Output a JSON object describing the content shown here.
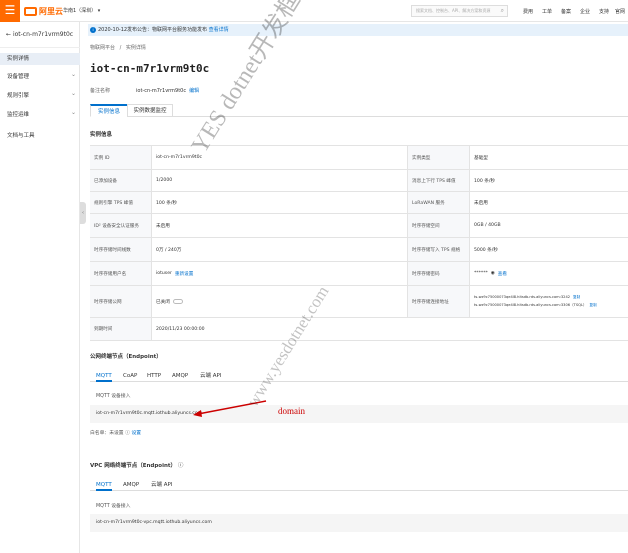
{
  "topbar": {
    "brand": "阿里云",
    "region": "华南1（深圳）",
    "search_placeholder": "搜索文档、控制台、API、解决方案和资源",
    "nav": [
      "费用",
      "工单",
      "备案",
      "企业",
      "支持",
      "官网"
    ]
  },
  "sidebar": {
    "back_label": "iot-cn-m7r1vrm9t0c",
    "items": [
      {
        "label": "实例详情",
        "active": true,
        "expandable": false
      },
      {
        "label": "设备管理",
        "active": false,
        "expandable": true
      },
      {
        "label": "规则引擎",
        "active": false,
        "expandable": true
      },
      {
        "label": "监控运维",
        "active": false,
        "expandable": true
      },
      {
        "label": "文档与工具",
        "active": false,
        "expandable": false
      }
    ]
  },
  "notice": {
    "text": "2020-10-12发布公告：物联网平台服务功能发布",
    "link": "查看详情"
  },
  "breadcrumb": [
    "物联网平台",
    "/",
    "实例详情"
  ],
  "page": {
    "title": "iot-cn-m7r1vrm9t0c",
    "remark_label": "备注名称",
    "remark_value": "iot-cn-m7r1vrm9t0c",
    "remark_edit": "编辑"
  },
  "tabs": [
    {
      "label": "实例信息",
      "active": true
    },
    {
      "label": "实例数据监控",
      "active": false
    }
  ],
  "instance_section": "实例信息",
  "instance_rows": [
    {
      "k1": "实例 ID",
      "v1": "iot-cn-m7r1vrm9t0c",
      "k2": "实例类型",
      "v2": "基础型"
    },
    {
      "k1": "已添加设备",
      "v1": "1/2000",
      "k2": "消息上下行 TPS 峰值",
      "v2": "100 条/秒"
    },
    {
      "k1": "规则引擎 TPS 峰值",
      "v1": "100 条/秒",
      "k2": "LoRaWAN 服务",
      "v2": "未启用"
    },
    {
      "k1": "ID² 设备安全认证服务",
      "v1": "未启用",
      "k2": "时序存储空间",
      "v2": "0GB / 40GB"
    },
    {
      "k1": "时序存储时间线数",
      "v1": "0万 / 240万",
      "k2": "时序存储写入 TPS 规格",
      "v2": "5000 条/秒"
    },
    {
      "k1": "时序存储用户名",
      "v1": "iotuser",
      "v1_link": "重新设置",
      "k2": "时序存储密码",
      "v2": "******",
      "v2_link": "查看"
    },
    {
      "k1": "时序存储公网",
      "v1": "已关闭",
      "k2": "时序存储连接地址",
      "v2": "ts-wz9c75000073qe4l8.hitsdb.rds.aliyuncs.com:3242",
      "v2_link": "复制",
      "v2b": "ts-wz9c75000073qe4l8.hitsdb.rds.aliyuncs.com:3306（TSQL）",
      "v2b_link": "复制"
    },
    {
      "k1": "到期时间",
      "v1": "2020/11/23 00:00:00",
      "k2": "",
      "v2": ""
    }
  ],
  "public_section": {
    "title": "公网终端节点（Endpoint）",
    "tabs": [
      "MQTT",
      "CoAP",
      "HTTP",
      "AMQP",
      "云端 API"
    ],
    "box_label": "MQTT 设备接入",
    "address": "iot-cn-m7r1vrm9t0c.mqtt.iothub.aliyuncs.com",
    "whitelist_label": "白名单：未设置",
    "whitelist_link": "设置"
  },
  "vpc_section": {
    "title": "VPC 网络终端节点（Endpoint）",
    "tabs": [
      "MQTT",
      "AMQP",
      "云端 API"
    ],
    "box_label": "MQTT 设备接入",
    "address": "iot-cn-m7r1vrm9t0c-vpc.mqtt.iothub.aliyuncs.com"
  },
  "annotation": {
    "label": "domain",
    "color": "#cc0000"
  },
  "watermark": {
    "line1": "YES dotnet开发框架",
    "line2": "www.yesdotnet.com"
  },
  "colors": {
    "brand": "#ff6a00",
    "link": "#0070cc",
    "notice_bg": "#e6f1fb"
  }
}
